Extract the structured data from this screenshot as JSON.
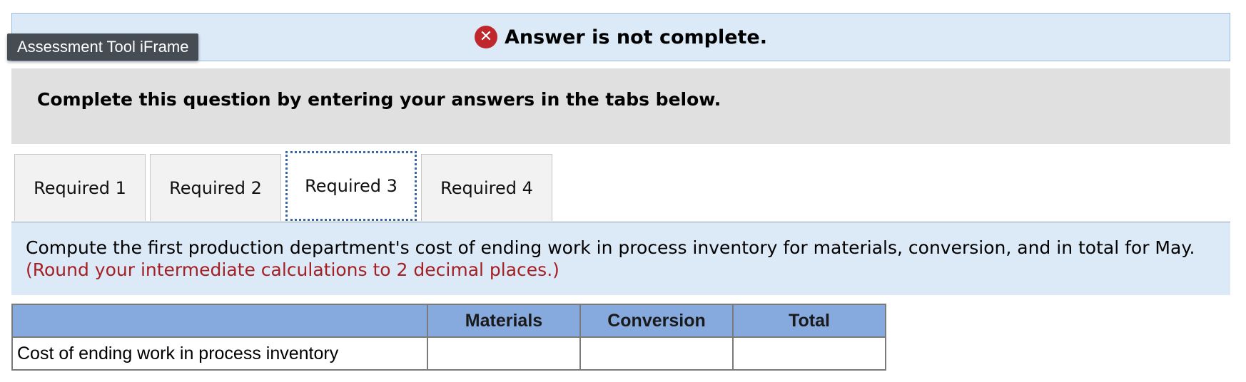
{
  "overlay": {
    "iframe_badge": "Assessment Tool iFrame"
  },
  "banner": {
    "icon": "x-circle-icon",
    "icon_glyph": "✕",
    "message": "Answer is not complete.",
    "icon_color": "#c0272d"
  },
  "instruction": {
    "text": "Complete this question by entering your answers in the tabs below."
  },
  "tabs": [
    {
      "label": "Required 1",
      "active": false
    },
    {
      "label": "Required 2",
      "active": false
    },
    {
      "label": "Required 3",
      "active": true
    },
    {
      "label": "Required 4",
      "active": false
    }
  ],
  "prompt": {
    "text": "Compute the first production department's cost of ending work in process inventory for materials, conversion, and in total for May.",
    "note": "(Round your intermediate calculations to 2 decimal places.)",
    "note_color": "#a51f23"
  },
  "table": {
    "headers": [
      "",
      "Materials",
      "Conversion",
      "Total"
    ],
    "rows": [
      {
        "label": "Cost of ending work in process inventory",
        "materials": "",
        "conversion": "",
        "total": ""
      }
    ],
    "header_color": "#86a9de"
  }
}
